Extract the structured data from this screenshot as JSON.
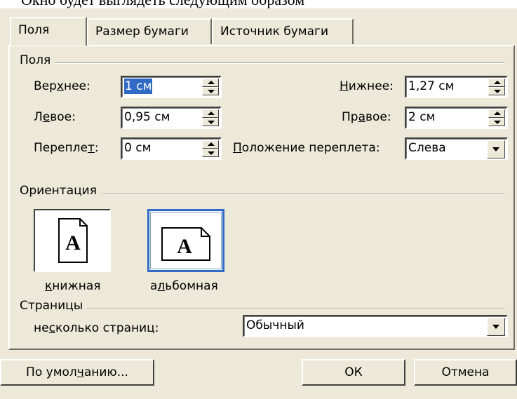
{
  "top_caption": "Окно будет выглядеть следующим образом",
  "tabs": [
    {
      "label": "Поля"
    },
    {
      "label": "Размер бумаги"
    },
    {
      "label": "Источник бумаги"
    }
  ],
  "margins": {
    "group_label": "Поля",
    "top": {
      "pre": "Вер",
      "acc": "х",
      "post": "нее:",
      "value": "1 см"
    },
    "bottom": {
      "pre": "",
      "acc": "Н",
      "post": "ижнее:",
      "value": "1,27 см"
    },
    "left": {
      "pre": "Л",
      "acc": "е",
      "post": "вое:",
      "value": "0,95 см"
    },
    "right": {
      "pre": "Пр",
      "acc": "а",
      "post": "вое:",
      "value": "2 см"
    },
    "gutter": {
      "pre": "Переплe",
      "acc": "т",
      "post": ":",
      "value": "0 см"
    },
    "gutter_pos": {
      "pre": "",
      "acc": "П",
      "post": "оложение переплета:",
      "value": "Слева"
    }
  },
  "orientation": {
    "group_label": "Ориентация",
    "portrait": {
      "pre": "",
      "acc": "к",
      "post": "нижная",
      "glyph": "A"
    },
    "landscape": {
      "pre": "а",
      "acc": "л",
      "post": "ьбомная",
      "glyph": "A"
    }
  },
  "pages": {
    "group_label": "Страницы",
    "multiple": {
      "pre": "не",
      "acc": "с",
      "post": "колько страниц:",
      "value": "Обычный"
    }
  },
  "buttons": {
    "default": {
      "pre": "По умол",
      "acc": "ч",
      "post": "анию..."
    },
    "ok": "ОК",
    "cancel": "Отмена"
  }
}
